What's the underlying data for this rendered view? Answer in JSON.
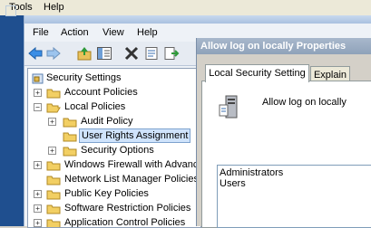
{
  "outer_menu": {
    "tools": "Tools",
    "help": "Help"
  },
  "mmc": {
    "menu": {
      "file": "File",
      "action": "Action",
      "view": "View",
      "help": "Help"
    },
    "toolbar": [
      "back-icon",
      "forward-icon",
      "up-folder-icon",
      "show-hide-tree-icon",
      "delete-icon",
      "properties-icon",
      "export-list-icon"
    ]
  },
  "tree": {
    "items": [
      {
        "label": "Security Settings",
        "icon": "security-settings-icon"
      },
      {
        "label": "Account Policies",
        "icon": "folder-icon"
      },
      {
        "label": "Local Policies",
        "icon": "folder-open-icon"
      },
      {
        "label": "Audit Policy",
        "icon": "folder-icon"
      },
      {
        "label": "User Rights Assignment",
        "icon": "folder-icon",
        "selected": true
      },
      {
        "label": "Security Options",
        "icon": "folder-icon"
      },
      {
        "label": "Windows Firewall with Advance",
        "icon": "folder-icon"
      },
      {
        "label": "Network List Manager Policies",
        "icon": "folder-icon"
      },
      {
        "label": "Public Key Policies",
        "icon": "folder-icon"
      },
      {
        "label": "Software Restriction Policies",
        "icon": "folder-icon"
      },
      {
        "label": "Application Control Policies",
        "icon": "folder-icon"
      }
    ]
  },
  "dialog": {
    "title": "Allow log on locally Properties",
    "tabs": [
      "Local Security Setting",
      "Explain"
    ],
    "policy_name": "Allow log on locally",
    "members": [
      "Administrators",
      "Users"
    ]
  },
  "colors": {
    "selection": "#cfe3fb",
    "dialog_title": "#8fa2ba",
    "frame": "#1f4f8f"
  }
}
